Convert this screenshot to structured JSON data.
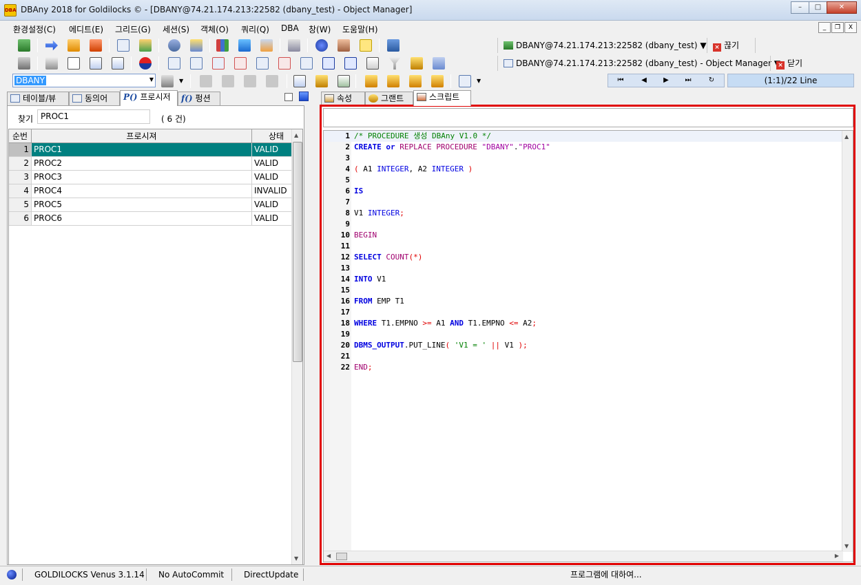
{
  "window": {
    "title": "DBAny 2018 for Goldilocks © - [DBANY@74.21.174.213:22582 (dbany_test) - Object Manager]",
    "app_icon_label": "DBA",
    "minimize": "–",
    "maximize": "□",
    "close": "✕"
  },
  "menu": {
    "items": [
      "환경설정(C)",
      "에디트(E)",
      "그리드(G)",
      "세션(S)",
      "객체(O)",
      "쿼리(Q)",
      "DBA",
      "창(W)",
      "도움말(H)"
    ],
    "mdi_minimize": "_",
    "mdi_restore": "❐",
    "mdi_close": "X"
  },
  "toolbar": {
    "connection1": "DBANY@74.21.174.213:22582 (dbany_test) ▼",
    "disconnect_label": "끊기",
    "connection2": "DBANY@74.21.174.213:22582 (dbany_test) - Object Manager ▼",
    "close_label": "닫기",
    "db_select_value": "DBANY",
    "nav": {
      "first": "⏮",
      "prev": "◀",
      "next": "▶",
      "last": "⏭",
      "refresh": "↻"
    },
    "line_status": "(1:1)/22 Line"
  },
  "left_panel": {
    "tabs": [
      "테이블/뷰",
      "동의어",
      "프로시저",
      "펑션"
    ],
    "tab_proc_prefix": "P()",
    "tab_func_prefix": "f()",
    "find_label": "찾기",
    "find_value": "PROC1",
    "find_count": "( 6 건)",
    "columns": [
      "순번",
      "프로시져",
      "상태"
    ],
    "rows": [
      {
        "num": "1",
        "name": "PROC1",
        "status": "VALID"
      },
      {
        "num": "2",
        "name": "PROC2",
        "status": "VALID"
      },
      {
        "num": "3",
        "name": "PROC3",
        "status": "VALID"
      },
      {
        "num": "4",
        "name": "PROC4",
        "status": "INVALID"
      },
      {
        "num": "5",
        "name": "PROC5",
        "status": "VALID"
      },
      {
        "num": "6",
        "name": "PROC6",
        "status": "VALID"
      }
    ]
  },
  "right_panel": {
    "tabs": [
      "속성",
      "그랜트",
      "스크립트"
    ]
  },
  "script": {
    "lines": [
      "1",
      "2",
      "3",
      "4",
      "5",
      "6",
      "7",
      "8",
      "9",
      "10",
      "11",
      "12",
      "13",
      "14",
      "15",
      "16",
      "17",
      "18",
      "19",
      "20",
      "21",
      "22"
    ]
  },
  "statusbar": {
    "db_version": "GOLDILOCKS Venus 3.1.14",
    "autocommit": "No AutoCommit",
    "update_mode": "DirectUpdate",
    "about": "프로그램에 대하여..."
  },
  "colors": {
    "selection": "#008080",
    "highlight_frame": "#e00000",
    "keyword": "#0000e0"
  }
}
